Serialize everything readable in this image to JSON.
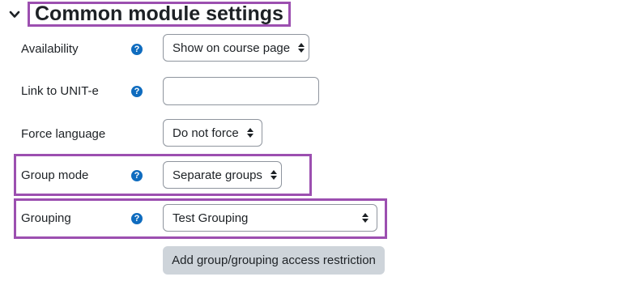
{
  "section": {
    "title": "Common module settings",
    "icon": "chevron-down-icon"
  },
  "fields": {
    "availability": {
      "label": "Availability",
      "help_icon": "question-circle-icon",
      "value": "Show on course page"
    },
    "link_unit_e": {
      "label": "Link to UNIT-e",
      "help_icon": "question-circle-icon",
      "value": ""
    },
    "force_language": {
      "label": "Force language",
      "value": "Do not force"
    },
    "group_mode": {
      "label": "Group mode",
      "help_icon": "question-circle-icon",
      "value": "Separate groups"
    },
    "grouping": {
      "label": "Grouping",
      "help_icon": "question-circle-icon",
      "value": "Test Grouping"
    }
  },
  "actions": {
    "add_restriction_label": "Add group/grouping access restriction"
  },
  "colors": {
    "highlight": "#9c4fb0",
    "help_icon": "#0f6cbf",
    "button_bg": "#ced4da",
    "text": "#1d2125"
  }
}
